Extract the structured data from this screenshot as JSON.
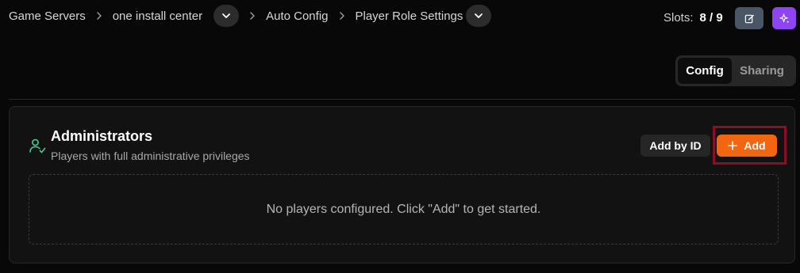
{
  "breadcrumb": {
    "items": [
      "Game Servers",
      "one install center",
      "Auto Config",
      "Player Role Settings"
    ]
  },
  "header": {
    "slots_label": "Slots:",
    "slots_value": "8 / 9"
  },
  "tabs": [
    {
      "label": "Config",
      "active": true
    },
    {
      "label": "Sharing",
      "active": false
    }
  ],
  "section": {
    "title": "Administrators",
    "subtitle": "Players with full administrative privileges",
    "add_by_id_label": "Add by ID",
    "add_label": "Add",
    "empty_message": "No players configured. Click \"Add\" to get started."
  },
  "colors": {
    "accent_orange": "#f26511",
    "ai_purple": "#8e44f0",
    "icon_green": "#3ecf8e",
    "highlight_outline": "#8b0f24"
  },
  "icons": {
    "separator": "chevron-right-icon",
    "dropdown": "chevron-down-icon",
    "edit": "edit-icon",
    "ai": "sparkle-icon",
    "section": "user-check-icon",
    "add": "plus-icon"
  }
}
